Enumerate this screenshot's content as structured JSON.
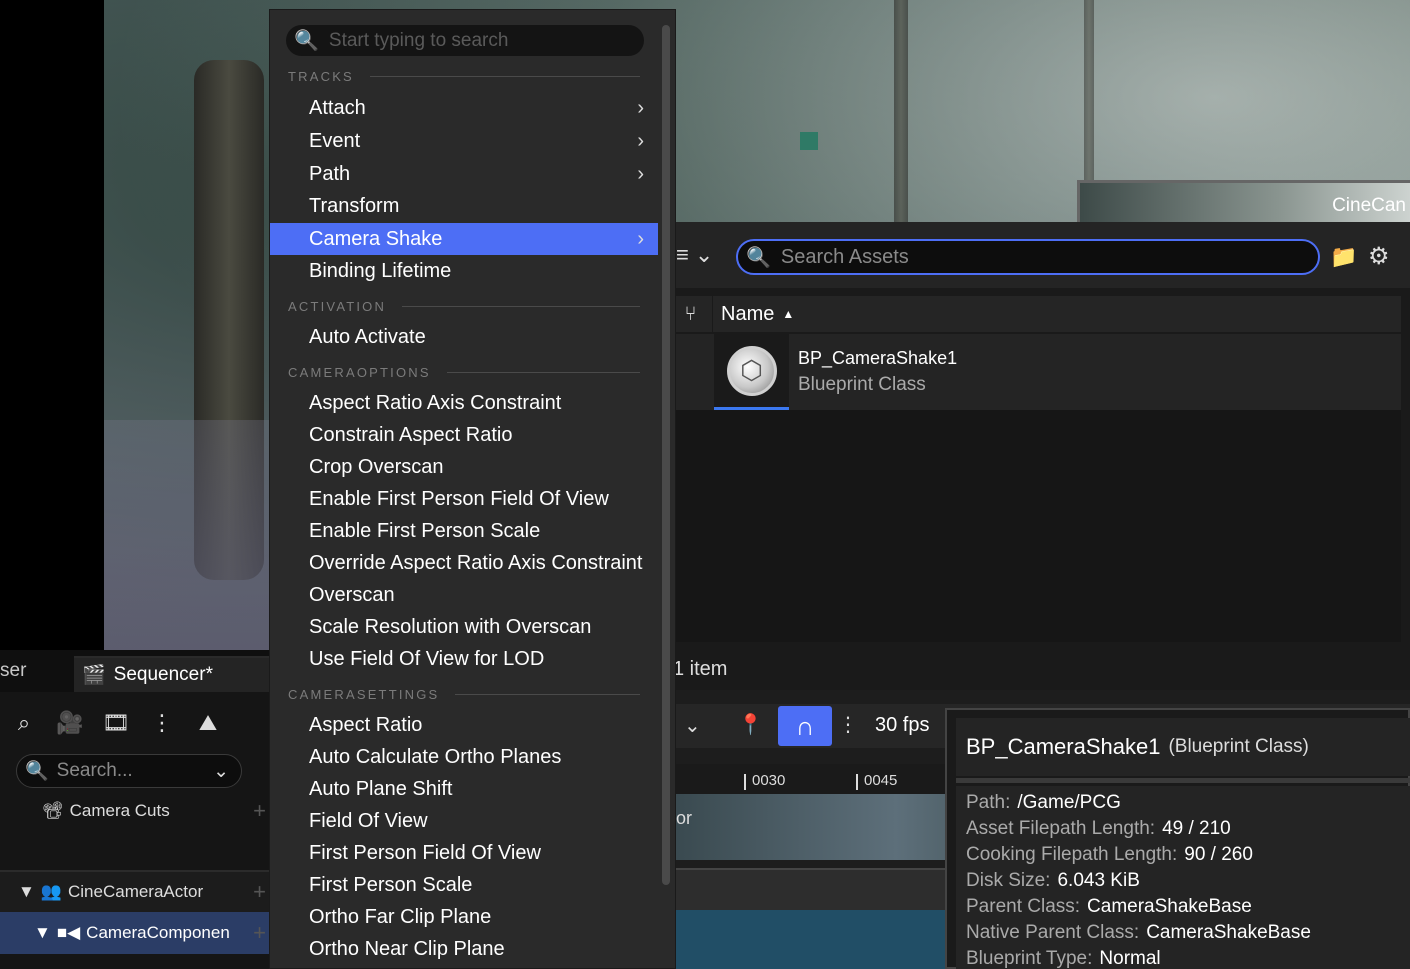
{
  "viewport": {
    "preview_label": "CineCan"
  },
  "sequencer": {
    "prev_tab_label": "ser",
    "tab_label": "Sequencer*",
    "search_placeholder": "Search...",
    "rows": {
      "camera_cuts": "Camera Cuts",
      "cine_camera_actor": "CineCameraActor",
      "camera_component": "CameraComponen"
    }
  },
  "menu": {
    "search_placeholder": "Start typing to search",
    "sections": {
      "tracks": "TRACKS",
      "activation": "ACTIVATION",
      "cameraoptions": "CAMERAOPTIONS",
      "camerasettings": "CAMERASETTINGS"
    },
    "tracks": [
      "Attach",
      "Event",
      "Path",
      "Transform",
      "Camera Shake",
      "Binding Lifetime"
    ],
    "activation": [
      "Auto Activate"
    ],
    "cameraoptions": [
      "Aspect Ratio Axis Constraint",
      "Constrain Aspect Ratio",
      "Crop Overscan",
      "Enable First Person Field Of View",
      "Enable First Person Scale",
      "Override Aspect Ratio Axis Constraint",
      "Overscan",
      "Scale Resolution with Overscan",
      "Use Field Of View for LOD"
    ],
    "camerasettings": [
      "Aspect Ratio",
      "Auto Calculate Ortho Planes",
      "Auto Plane Shift",
      "Field Of View",
      "First Person Field Of View",
      "First Person Scale",
      "Ortho Far Clip Plane",
      "Ortho Near Clip Plane"
    ],
    "selected_item": "Camera Shake"
  },
  "content_browser": {
    "search_placeholder": "Search Assets",
    "column_name": "Name",
    "asset": {
      "name": "BP_CameraShake1",
      "type": "Blueprint Class"
    },
    "item_count": "1 item"
  },
  "timeline": {
    "fps": "30 fps",
    "ticks": [
      "0030",
      "0045"
    ],
    "partial_label": "or"
  },
  "tooltip": {
    "title": "BP_CameraShake1",
    "kind": "(Blueprint Class)",
    "props": [
      {
        "key": "Path:",
        "value": "/Game/PCG"
      },
      {
        "key": "Asset Filepath Length:",
        "value": "49 / 210"
      },
      {
        "key": "Cooking Filepath Length:",
        "value": "90 / 260"
      },
      {
        "key": "Disk Size:",
        "value": "6.043 KiB"
      },
      {
        "key": "Parent Class:",
        "value": "CameraShakeBase"
      },
      {
        "key": "Native Parent Class:",
        "value": "CameraShakeBase"
      },
      {
        "key": "Blueprint Type:",
        "value": "Normal"
      }
    ]
  },
  "colors": {
    "accent": "#4d6ef5",
    "menu_bg": "#2a2a2a",
    "panel_bg": "#1a1a1a",
    "selected_row": "#2b3d66"
  }
}
